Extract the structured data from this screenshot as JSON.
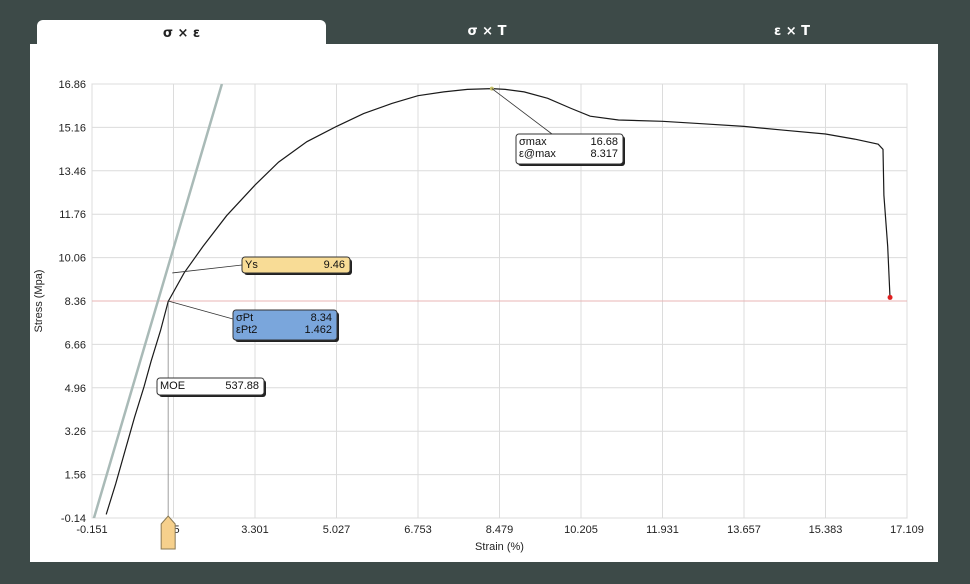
{
  "tabs": [
    {
      "label": "σ × ε",
      "active": true
    },
    {
      "label": "σ × T",
      "active": false
    },
    {
      "label": "ε × T",
      "active": false
    }
  ],
  "chart_data": {
    "type": "line",
    "xlabel": "Strain (%)",
    "ylabel": "Stress (Mpa)",
    "xlim": [
      -0.151,
      17.109
    ],
    "ylim": [
      -0.14,
      16.86
    ],
    "xticks": [
      "-0.151",
      "75",
      "3.301",
      "5.027",
      "6.753",
      "8.479",
      "10.205",
      "11.931",
      "13.657",
      "15.383",
      "17.109"
    ],
    "yticks": [
      "-0.14",
      "1.56",
      "3.26",
      "4.96",
      "6.66",
      "8.36",
      "10.06",
      "11.76",
      "13.46",
      "15.16",
      "16.86"
    ],
    "grid": true,
    "series": [
      {
        "x": [
          0.15,
          0.35,
          0.55,
          0.75,
          0.95,
          1.1,
          1.3,
          1.462,
          1.8,
          2.2,
          2.7,
          3.301,
          3.8,
          4.4,
          5.027,
          5.6,
          6.2,
          6.753,
          7.3,
          7.8,
          8.317,
          8.6,
          9.0,
          9.5,
          10.0,
          10.4,
          11.0,
          11.931,
          12.8,
          13.657,
          14.5,
          15.383,
          16.0,
          16.5,
          16.6,
          16.62,
          16.7,
          16.75
        ],
        "y": [
          0.0,
          1.2,
          2.5,
          3.8,
          5.0,
          6.0,
          7.2,
          8.34,
          9.46,
          10.5,
          11.7,
          12.9,
          13.8,
          14.6,
          15.2,
          15.7,
          16.1,
          16.4,
          16.55,
          16.65,
          16.68,
          16.65,
          16.55,
          16.3,
          15.9,
          15.6,
          15.45,
          15.4,
          15.3,
          15.2,
          15.05,
          14.9,
          14.7,
          14.5,
          14.3,
          12.5,
          10.5,
          8.5
        ]
      }
    ],
    "modulus_line": {
      "x": [
        -0.151,
        2.6
      ],
      "y": [
        -0.4,
        16.86
      ]
    },
    "end_point": {
      "x": 16.75,
      "y": 8.5
    },
    "max_point": {
      "x": 8.317,
      "y": 16.68
    },
    "annotations": [
      {
        "label": "σmax",
        "value": "16.68",
        "label2": "ε@max",
        "value2": "8.317"
      },
      {
        "label": "Ys",
        "value": "9.46"
      },
      {
        "label": "σPt",
        "value": "8.34",
        "label2": "εPt2",
        "value2": "1.462"
      },
      {
        "label": "MOE",
        "value": "537.88"
      }
    ]
  }
}
